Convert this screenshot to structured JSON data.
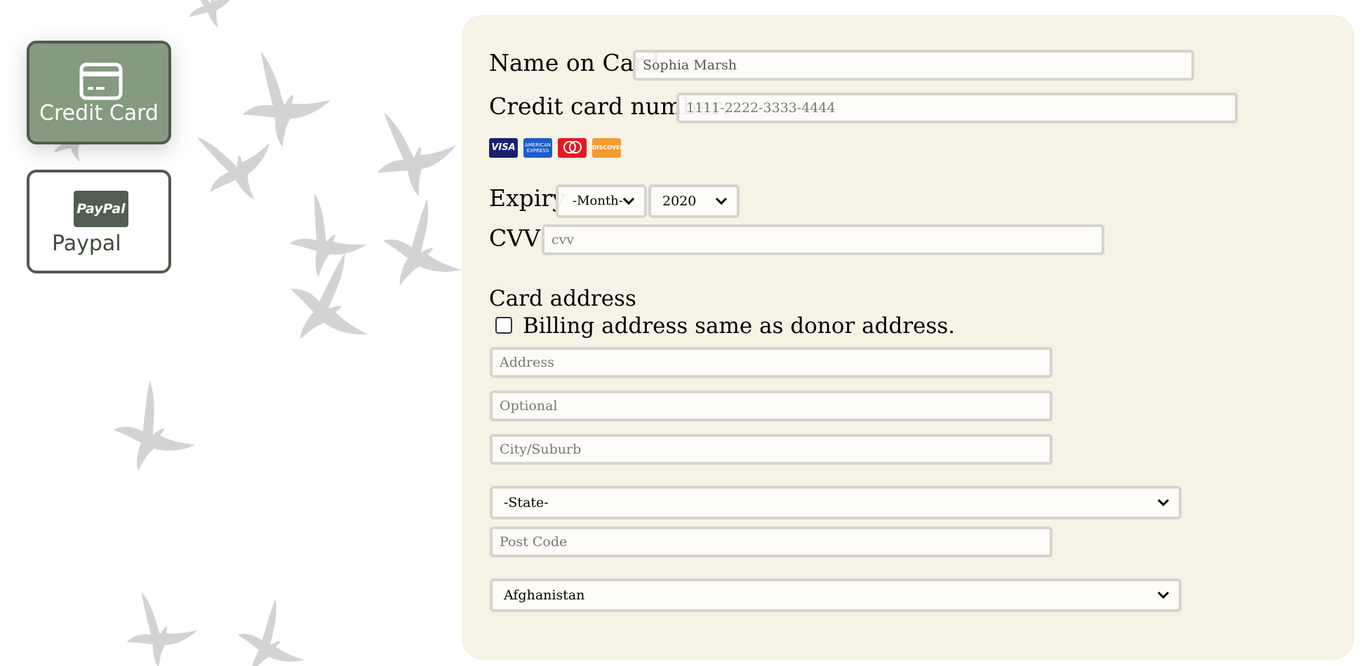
{
  "payment_methods": [
    {
      "label": "Credit Card",
      "icon": "credit-card-icon",
      "selected": true
    },
    {
      "label": "Paypal",
      "icon": "paypal-logo",
      "logo_text": "PayPal",
      "selected": false
    }
  ],
  "form": {
    "name_on_card": {
      "label": "Name on Card:",
      "value": "Sophia Marsh"
    },
    "card_number": {
      "label": "Credit card number:",
      "placeholder": "1111-2222-3333-4444"
    },
    "card_logos": [
      {
        "name": "visa",
        "text": "VISA"
      },
      {
        "name": "amex",
        "text": "AMERICAN EXPRESS"
      },
      {
        "name": "mastercard",
        "text": ""
      },
      {
        "name": "discover",
        "text": "DISCOVER"
      }
    ],
    "expiry": {
      "label": "Expiry",
      "month": "-Month-",
      "year": "2020"
    },
    "cvv": {
      "label": "CVV",
      "placeholder": "cvv"
    },
    "card_address": {
      "heading": "Card address",
      "same_as_donor_label": "Billing address same as donor address.",
      "same_as_donor_checked": false,
      "address_placeholder": "Address",
      "optional_placeholder": "Optional",
      "city_placeholder": "City/Suburb",
      "state": "-State-",
      "postcode_placeholder": "Post Code",
      "country": "Afghanistan"
    }
  },
  "colors": {
    "selected_method_bg": "#859a80",
    "method_border": "#4f5b4d",
    "panel_bg": "#f4f1e2",
    "input_border": "#d5d4cf"
  }
}
